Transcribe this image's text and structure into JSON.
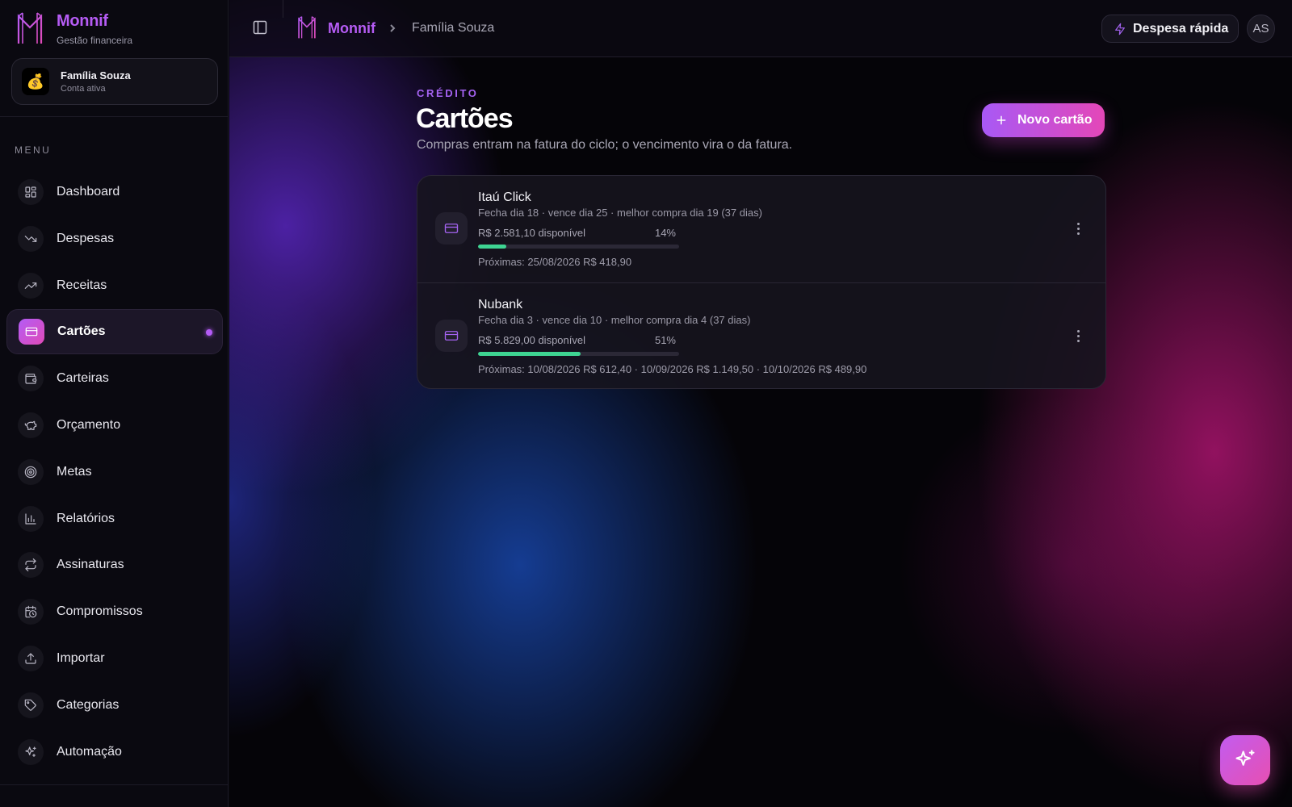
{
  "brand": {
    "name": "Monnif",
    "subtitle": "Gestão financeira",
    "color": "#b65cf5"
  },
  "account": {
    "name": "Família Souza",
    "status": "Conta ativa",
    "emoji": "💰"
  },
  "sidebar": {
    "menu_label": "MENU",
    "items": [
      {
        "label": "Dashboard",
        "icon": "grid-icon",
        "active": false
      },
      {
        "label": "Despesas",
        "icon": "trending-down-icon",
        "active": false
      },
      {
        "label": "Receitas",
        "icon": "trending-up-icon",
        "active": false
      },
      {
        "label": "Cartões",
        "icon": "credit-card-icon",
        "active": true
      },
      {
        "label": "Carteiras",
        "icon": "wallet-icon",
        "active": false
      },
      {
        "label": "Orçamento",
        "icon": "piggy-bank-icon",
        "active": false
      },
      {
        "label": "Metas",
        "icon": "target-icon",
        "active": false
      },
      {
        "label": "Relatórios",
        "icon": "bar-chart-icon",
        "active": false
      },
      {
        "label": "Assinaturas",
        "icon": "repeat-icon",
        "active": false
      },
      {
        "label": "Compromissos",
        "icon": "calendar-clock-icon",
        "active": false
      },
      {
        "label": "Importar",
        "icon": "upload-icon",
        "active": false
      },
      {
        "label": "Categorias",
        "icon": "tag-icon",
        "active": false
      },
      {
        "label": "Automação",
        "icon": "sparkles-icon",
        "active": false
      }
    ]
  },
  "topbar": {
    "breadcrumb_brand": "Monnif",
    "breadcrumb_current": "Família Souza",
    "quick_expense_label": "Despesa rápida",
    "user_initials": "AS"
  },
  "page": {
    "eyebrow": "CRÉDITO",
    "title": "Cartões",
    "description": "Compras entram na fatura do ciclo; o vencimento vira o da fatura.",
    "new_card_label": "Novo cartão"
  },
  "cards": [
    {
      "name": "Itaú Click",
      "meta": "Fecha dia 18 · vence dia 25 · melhor compra dia 19 (37 dias)",
      "available": "R$ 2.581,10 disponível",
      "percent_label": "14%",
      "usage_fraction": 0.14,
      "next": "Próximas: 25/08/2026 R$ 418,90"
    },
    {
      "name": "Nubank",
      "meta": "Fecha dia 3 · vence dia 10 · melhor compra dia 4 (37 dias)",
      "available": "R$ 5.829,00 disponível",
      "percent_label": "51%",
      "usage_fraction": 0.51,
      "next": "Próximas: 10/08/2026 R$ 612,40 · 10/09/2026 R$ 1.149,50 · 10/10/2026 R$ 489,90"
    }
  ],
  "colors": {
    "accent": "#b45cf6",
    "accent_pink": "#e447b8",
    "progress": "#3ed492"
  }
}
